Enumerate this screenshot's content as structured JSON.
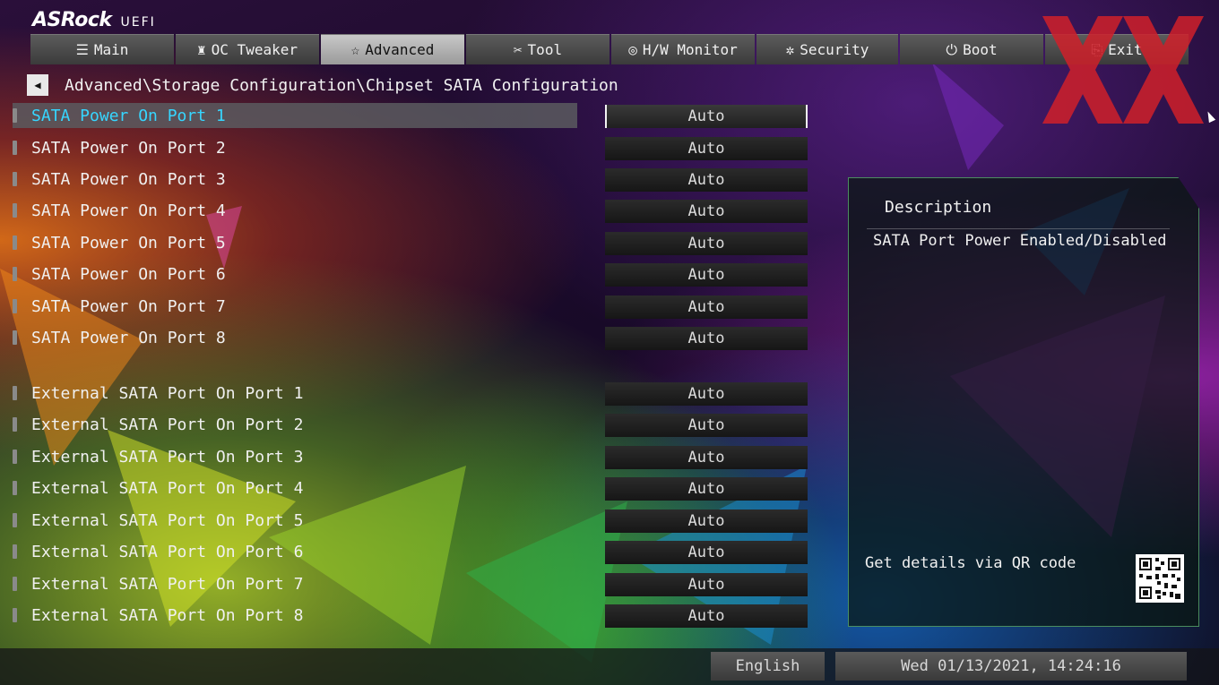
{
  "header": {
    "brand": "ASRock",
    "product": "UEFI"
  },
  "tabs": [
    {
      "label": "Main",
      "icon": "list-icon",
      "glyph": "☰"
    },
    {
      "label": "OC Tweaker",
      "icon": "rocket-icon",
      "glyph": "♜"
    },
    {
      "label": "Advanced",
      "icon": "star-icon",
      "glyph": "☆"
    },
    {
      "label": "Tool",
      "icon": "tools-icon",
      "glyph": "✂"
    },
    {
      "label": "H/W Monitor",
      "icon": "monitor-icon",
      "glyph": "◎"
    },
    {
      "label": "Security",
      "icon": "shield-icon",
      "glyph": "✲"
    },
    {
      "label": "Boot",
      "icon": "power-icon",
      "glyph": "⏻"
    },
    {
      "label": "Exit",
      "icon": "exit-icon",
      "glyph": "⎘"
    }
  ],
  "breadcrumb": {
    "path": "Advanced\\Storage Configuration\\Chipset SATA Configuration"
  },
  "settings": [
    {
      "label": "SATA Power On Port 1",
      "value": "Auto"
    },
    {
      "label": "SATA Power On Port 2",
      "value": "Auto"
    },
    {
      "label": "SATA Power On Port 3",
      "value": "Auto"
    },
    {
      "label": "SATA Power On Port 4",
      "value": "Auto"
    },
    {
      "label": "SATA Power On Port 5",
      "value": "Auto"
    },
    {
      "label": "SATA Power On Port 6",
      "value": "Auto"
    },
    {
      "label": "SATA Power On Port 7",
      "value": "Auto"
    },
    {
      "label": "SATA Power On Port 8",
      "value": "Auto"
    },
    {
      "label": "External SATA Port On Port 1",
      "value": "Auto"
    },
    {
      "label": "External SATA Port On Port 2",
      "value": "Auto"
    },
    {
      "label": "External SATA Port On Port 3",
      "value": "Auto"
    },
    {
      "label": "External SATA Port On Port 4",
      "value": "Auto"
    },
    {
      "label": "External SATA Port On Port 5",
      "value": "Auto"
    },
    {
      "label": "External SATA Port On Port 6",
      "value": "Auto"
    },
    {
      "label": "External SATA Port On Port 7",
      "value": "Auto"
    },
    {
      "label": "External SATA Port On Port 8",
      "value": "Auto"
    }
  ],
  "description": {
    "title": "Description",
    "text": "SATA Port Power Enabled/Disabled",
    "qr_text": "Get details via QR code"
  },
  "footer": {
    "language": "English",
    "datetime": "Wed 01/13/2021, 14:24:16"
  },
  "colors": {
    "selected_text": "#36d6ff",
    "watermark": "#d0202a",
    "active_tab": "#b8b8b8"
  }
}
